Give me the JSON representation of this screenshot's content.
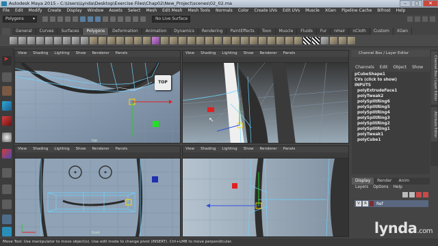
{
  "window": {
    "title": "Autodesk Maya 2015 - C:\\Users\\Lynda\\Desktop\\Exercise Files\\Chap02\\New_Project\\scenes\\02_02.ma",
    "minimize": "–",
    "maximize": "□",
    "close": "✕"
  },
  "menubar": [
    "File",
    "Edit",
    "Modify",
    "Create",
    "Display",
    "Window",
    "Assets",
    "Select",
    "Mesh",
    "Edit Mesh",
    "Mesh Tools",
    "Normals",
    "Color",
    "Create UVs",
    "Edit UVs",
    "Muscle",
    "XGen",
    "Pipeline Cache",
    "Bifrost",
    "Help"
  ],
  "statusline": {
    "mode": "Polygons",
    "live_surface": "No Live Surface"
  },
  "shelf_tabs": [
    "General",
    "Curves",
    "Surfaces",
    "Polygons",
    "Deformation",
    "Animation",
    "Dynamics",
    "Rendering",
    "PaintEffects",
    "Toon",
    "Muscle",
    "Fluids",
    "Fur",
    "nHair",
    "nCloth",
    "Custom",
    "XGen"
  ],
  "shelf_active": "Polygons",
  "viewport_menu": [
    "View",
    "Shading",
    "Lighting",
    "Show",
    "Renderer",
    "Panels"
  ],
  "viewports": {
    "top_left": {
      "label": "top",
      "cube_label": "TOP"
    },
    "top_right": {
      "label": ""
    },
    "bottom_left": {
      "label": "front"
    },
    "bottom_right": {
      "label": ""
    }
  },
  "channel_box": {
    "header": "Channel Box / Layer Editor",
    "menu": [
      "Channels",
      "Edit",
      "Object",
      "Show"
    ],
    "object_name": "pCubeShape1",
    "cvs": "CVs (click to show)",
    "inputs_label": "INPUTS",
    "inputs": [
      "polyExtrudeFace1",
      "polyTweak2",
      "polySplitRing6",
      "polySplitRing5",
      "polySplitRing4",
      "polySplitRing3",
      "polySplitRing2",
      "polySplitRing1",
      "polyTweak1",
      "polyCube1"
    ]
  },
  "side_tabs": [
    "Channel Box / Layer Editor",
    "Attribute Editor"
  ],
  "layer_editor": {
    "tabs": [
      "Display",
      "Render",
      "Anim"
    ],
    "active_tab": "Display",
    "menu": [
      "Layers",
      "Options",
      "Help"
    ],
    "layer": {
      "visible": "V",
      "reference": "R",
      "name": "Ref"
    }
  },
  "helpline": "Move Tool: Use manipulator to move object(s). Use edit mode to change pivot (INSERT). Ctrl+LMB to move perpendicular.",
  "watermark": {
    "brand": "lynda",
    "suffix": ".com"
  }
}
